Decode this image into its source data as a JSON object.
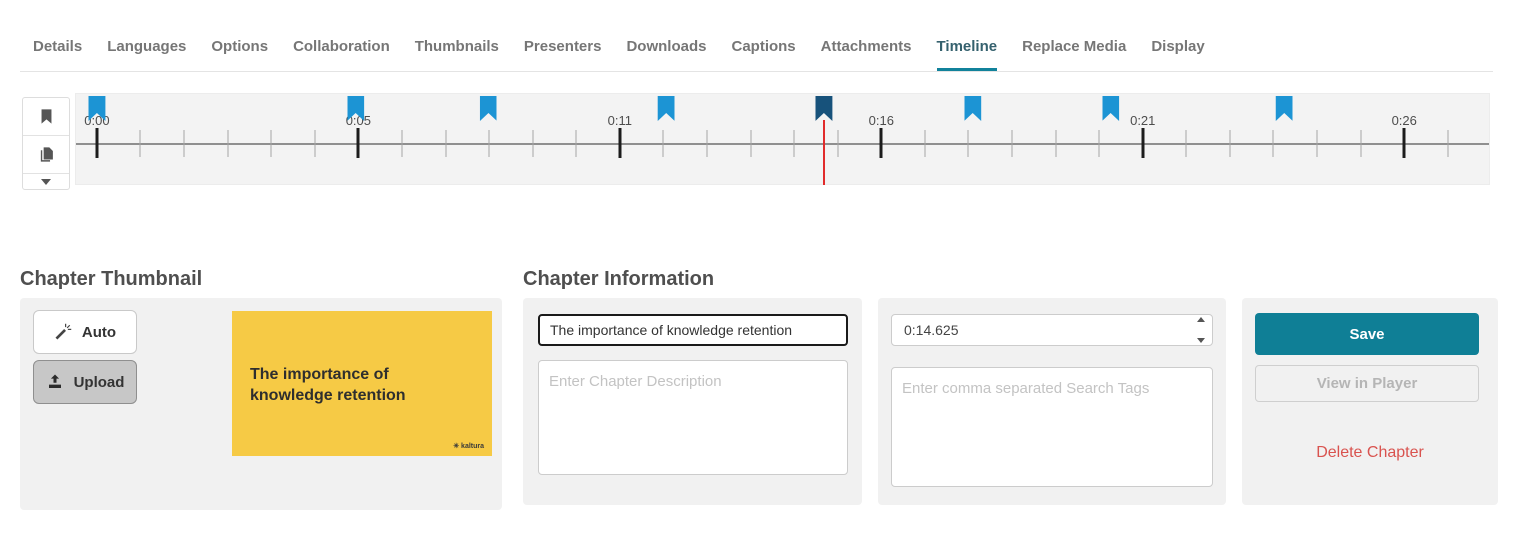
{
  "tabs": {
    "items": [
      {
        "label": "Details"
      },
      {
        "label": "Languages"
      },
      {
        "label": "Options"
      },
      {
        "label": "Collaboration"
      },
      {
        "label": "Thumbnails"
      },
      {
        "label": "Presenters"
      },
      {
        "label": "Downloads"
      },
      {
        "label": "Captions"
      },
      {
        "label": "Attachments"
      },
      {
        "label": "Timeline"
      },
      {
        "label": "Replace Media"
      },
      {
        "label": "Display"
      }
    ],
    "active": "Timeline"
  },
  "timeline": {
    "tools": [
      {
        "icon": "bookmark-icon"
      },
      {
        "icon": "slides-icon"
      }
    ],
    "expander_icon": "caret-down-icon",
    "ruler": {
      "start_pct": 1.48,
      "minor_spacing_pct": 3.084,
      "tick_total": 32,
      "major_every": 6,
      "labels": [
        "0:00",
        "0:05",
        "0:11",
        "0:16",
        "0:21",
        "0:26"
      ]
    },
    "markers": [
      {
        "pct": 1.48,
        "selected": false
      },
      {
        "pct": 19.79,
        "selected": false
      },
      {
        "pct": 29.19,
        "selected": false
      },
      {
        "pct": 41.77,
        "selected": false
      },
      {
        "pct": 52.93,
        "selected": true
      },
      {
        "pct": 63.46,
        "selected": false
      },
      {
        "pct": 73.22,
        "selected": false
      },
      {
        "pct": 85.51,
        "selected": false
      }
    ],
    "playhead_pct": 52.93
  },
  "chapter_thumbnail": {
    "heading": "Chapter Thumbnail",
    "auto_label": "Auto",
    "upload_label": "Upload",
    "preview": {
      "line1": "The importance of",
      "line2": "knowledge retention",
      "logo_text": "✳ kaltura"
    }
  },
  "chapter_information": {
    "heading": "Chapter Information",
    "title_value": "The importance of knowledge retention",
    "description_placeholder": "Enter Chapter Description",
    "time_value": "0:14.625",
    "tags_placeholder": "Enter comma separated Search Tags"
  },
  "actions": {
    "save_label": "Save",
    "view_in_player_label": "View in Player",
    "delete_chapter_label": "Delete Chapter"
  },
  "colors": {
    "accent_teal": "#11829b",
    "save_teal": "#0f7f96",
    "flag_blue": "#1c94d4",
    "flag_selected": "#17527b",
    "playhead_red": "#e12b2b",
    "delete_red": "#d9534f",
    "thumbnail_yellow": "#f6ca45"
  }
}
